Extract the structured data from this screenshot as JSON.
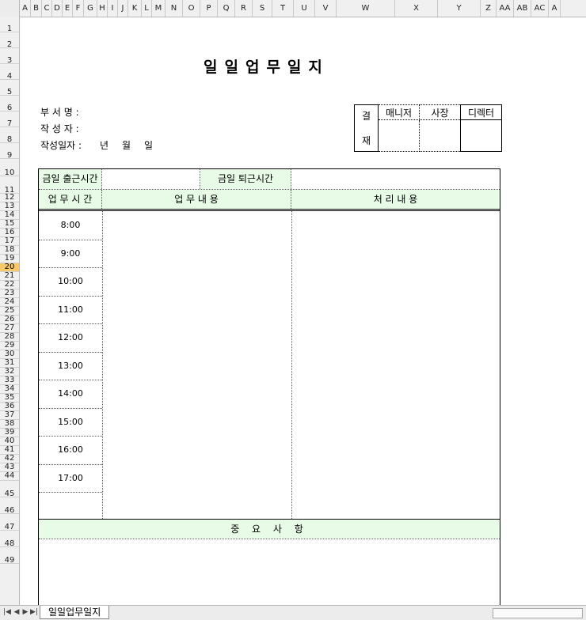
{
  "columns": [
    "A",
    "B",
    "C",
    "D",
    "E",
    "F",
    "G",
    "H",
    "I",
    "J",
    "K",
    "L",
    "M",
    "N",
    "O",
    "P",
    "Q",
    "R",
    "S",
    "T",
    "U",
    "V",
    "W",
    "X",
    "Y",
    "Z",
    "AA",
    "AB",
    "AC",
    "A"
  ],
  "rows": [
    "1",
    "2",
    "3",
    "4",
    "5",
    "6",
    "7",
    "8",
    "9",
    "10",
    "11",
    "12",
    "13",
    "14",
    "15",
    "16",
    "17",
    "18",
    "19",
    "20",
    "21",
    "22",
    "23",
    "24",
    "25",
    "26",
    "27",
    "28",
    "29",
    "30",
    "31",
    "32",
    "33",
    "34",
    "35",
    "36",
    "37",
    "38",
    "39",
    "40",
    "41",
    "42",
    "43",
    "44",
    "45",
    "46",
    "47",
    "48",
    "49"
  ],
  "selected_row": "20",
  "doc": {
    "title": "일일업무일지",
    "dept_label": "부 서 명 :",
    "writer_label": "작 성 자 :",
    "date_label": "작성일자 :",
    "year": "년",
    "month": "월",
    "day": "일"
  },
  "approval": {
    "side_top": "결",
    "side_bottom": "재",
    "headers": [
      "매니저",
      "사장",
      "디렉터"
    ]
  },
  "table": {
    "checkin_label": "금일 출근시간",
    "checkout_label": "금일 퇴근시간",
    "col_time": "업 무 시 간",
    "col_work": "업 무 내 용",
    "col_result": "처 리 내 용",
    "times": [
      "8:00",
      "9:00",
      "10:00",
      "11:00",
      "12:00",
      "13:00",
      "14:00",
      "15:00",
      "16:00",
      "17:00"
    ],
    "notes_label": "중 요 사 항"
  },
  "sheet_tab": "일일업무일지"
}
